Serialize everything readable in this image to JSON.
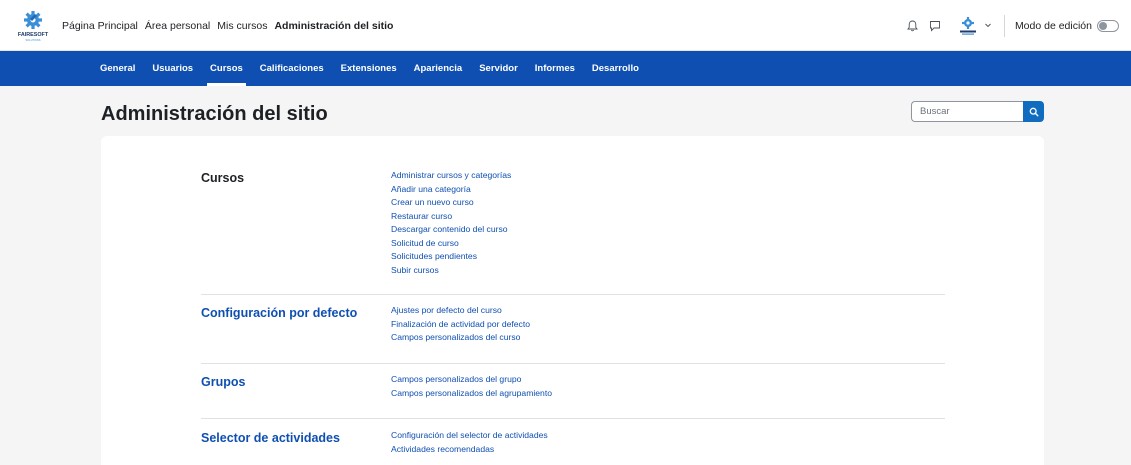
{
  "brand": {
    "logo_text": "FAIRESOFT",
    "logo_subtext": "SOLUTIONS",
    "accent": "#0f4fb1"
  },
  "topnav": {
    "items": [
      {
        "label": "Página Principal"
      },
      {
        "label": "Área personal"
      },
      {
        "label": "Mis cursos"
      },
      {
        "label": "Administración del sitio",
        "active": true
      }
    ]
  },
  "topright": {
    "notification_icon": "bell-icon",
    "messages_icon": "chat-icon",
    "edit_mode_label": "Modo de edición",
    "edit_mode_on": false
  },
  "secnav": {
    "items": [
      {
        "label": "General"
      },
      {
        "label": "Usuarios"
      },
      {
        "label": "Cursos",
        "active": true
      },
      {
        "label": "Calificaciones"
      },
      {
        "label": "Extensiones"
      },
      {
        "label": "Apariencia"
      },
      {
        "label": "Servidor"
      },
      {
        "label": "Informes"
      },
      {
        "label": "Desarrollo"
      }
    ]
  },
  "page": {
    "title": "Administración del sitio"
  },
  "search": {
    "placeholder": "Buscar"
  },
  "sections": [
    {
      "title": "Cursos",
      "links": [
        "Administrar cursos y categorías",
        "Añadir una categoría",
        "Crear un nuevo curso",
        "Restaurar curso",
        "Descargar contenido del curso",
        "Solicitud de curso",
        "Solicitudes pendientes",
        "Subir cursos"
      ]
    },
    {
      "title": "Configuración por defecto",
      "links": [
        "Ajustes por defecto del curso",
        "Finalización de actividad por defecto",
        "Campos personalizados del curso"
      ]
    },
    {
      "title": "Grupos",
      "links": [
        "Campos personalizados del grupo",
        "Campos personalizados del agrupamiento"
      ]
    },
    {
      "title": "Selector de actividades",
      "links": [
        "Configuración del selector de actividades",
        "Actividades recomendadas"
      ]
    }
  ]
}
